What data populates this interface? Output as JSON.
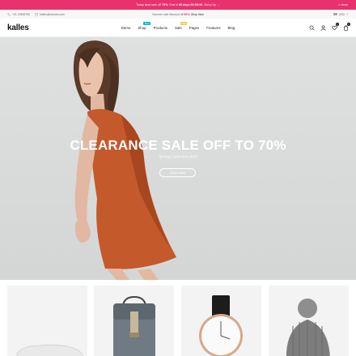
{
  "promo": {
    "text_pre": "Today deal sale off ",
    "text_bold": "70%",
    "text_mid": ". End in ",
    "countdown": "00 days 00:00:00",
    "text_post": ". Hurry Up →",
    "close_label": "× close"
  },
  "infobar": {
    "phone": "+01 23456789",
    "email": "Kalles@domain.com",
    "summer_pre": "Summer sale discount off ",
    "summer_pct": "50%",
    "summer_post": "! ",
    "shop_now": "Shop Now",
    "currency": "USD"
  },
  "header": {
    "logo": "kalles",
    "nav": [
      {
        "label": "Demo",
        "badge": ""
      },
      {
        "label": "Shop",
        "badge": "New"
      },
      {
        "label": "Products",
        "badge": ""
      },
      {
        "label": "Sale",
        "badge": "Sale"
      },
      {
        "label": "Pages",
        "badge": ""
      },
      {
        "label": "Features",
        "badge": ""
      },
      {
        "label": "Blog",
        "badge": ""
      }
    ],
    "wishlist_count": "0",
    "cart_count": "0"
  },
  "hero": {
    "title": "CLEARANCE SALE OFF TO 70%",
    "subtitle": "Spring Collection 2020",
    "button": "Shop Now"
  },
  "icons": {
    "phone": "phone-icon",
    "mail": "mail-icon",
    "search": "search-icon",
    "account": "user-icon",
    "wishlist": "heart-icon",
    "cart": "cart-icon"
  },
  "colors": {
    "accent": "#e8326e",
    "badge_new": "#01bad4",
    "badge_sale": "#f6c944"
  }
}
